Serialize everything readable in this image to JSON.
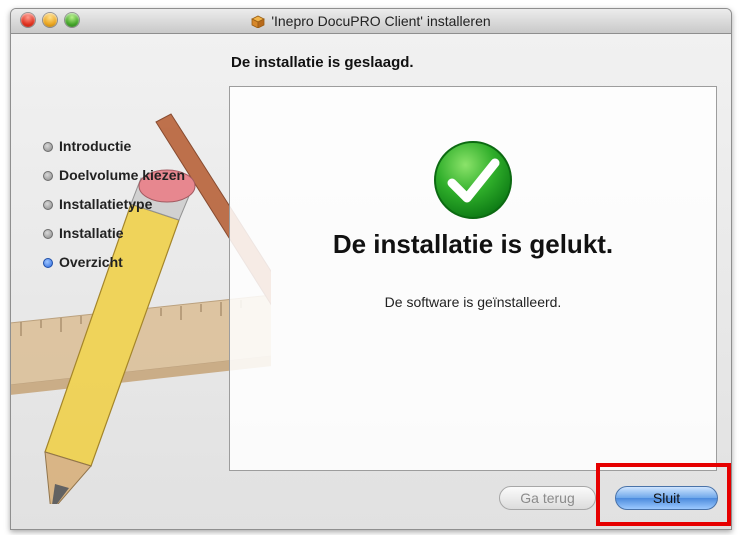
{
  "window": {
    "title": "'Inepro DocuPRO Client' installeren"
  },
  "heading": "De installatie is geslaagd.",
  "steps": [
    {
      "label": "Introductie",
      "active": false
    },
    {
      "label": "Doelvolume kiezen",
      "active": false
    },
    {
      "label": "Installatietype",
      "active": false
    },
    {
      "label": "Installatie",
      "active": false
    },
    {
      "label": "Overzicht",
      "active": true
    }
  ],
  "main": {
    "title": "De installatie is gelukt.",
    "message": "De software is geïnstalleerd."
  },
  "buttons": {
    "back": "Ga terug",
    "close": "Sluit"
  },
  "icons": {
    "success": "checkmark-icon",
    "package": "package-icon"
  }
}
